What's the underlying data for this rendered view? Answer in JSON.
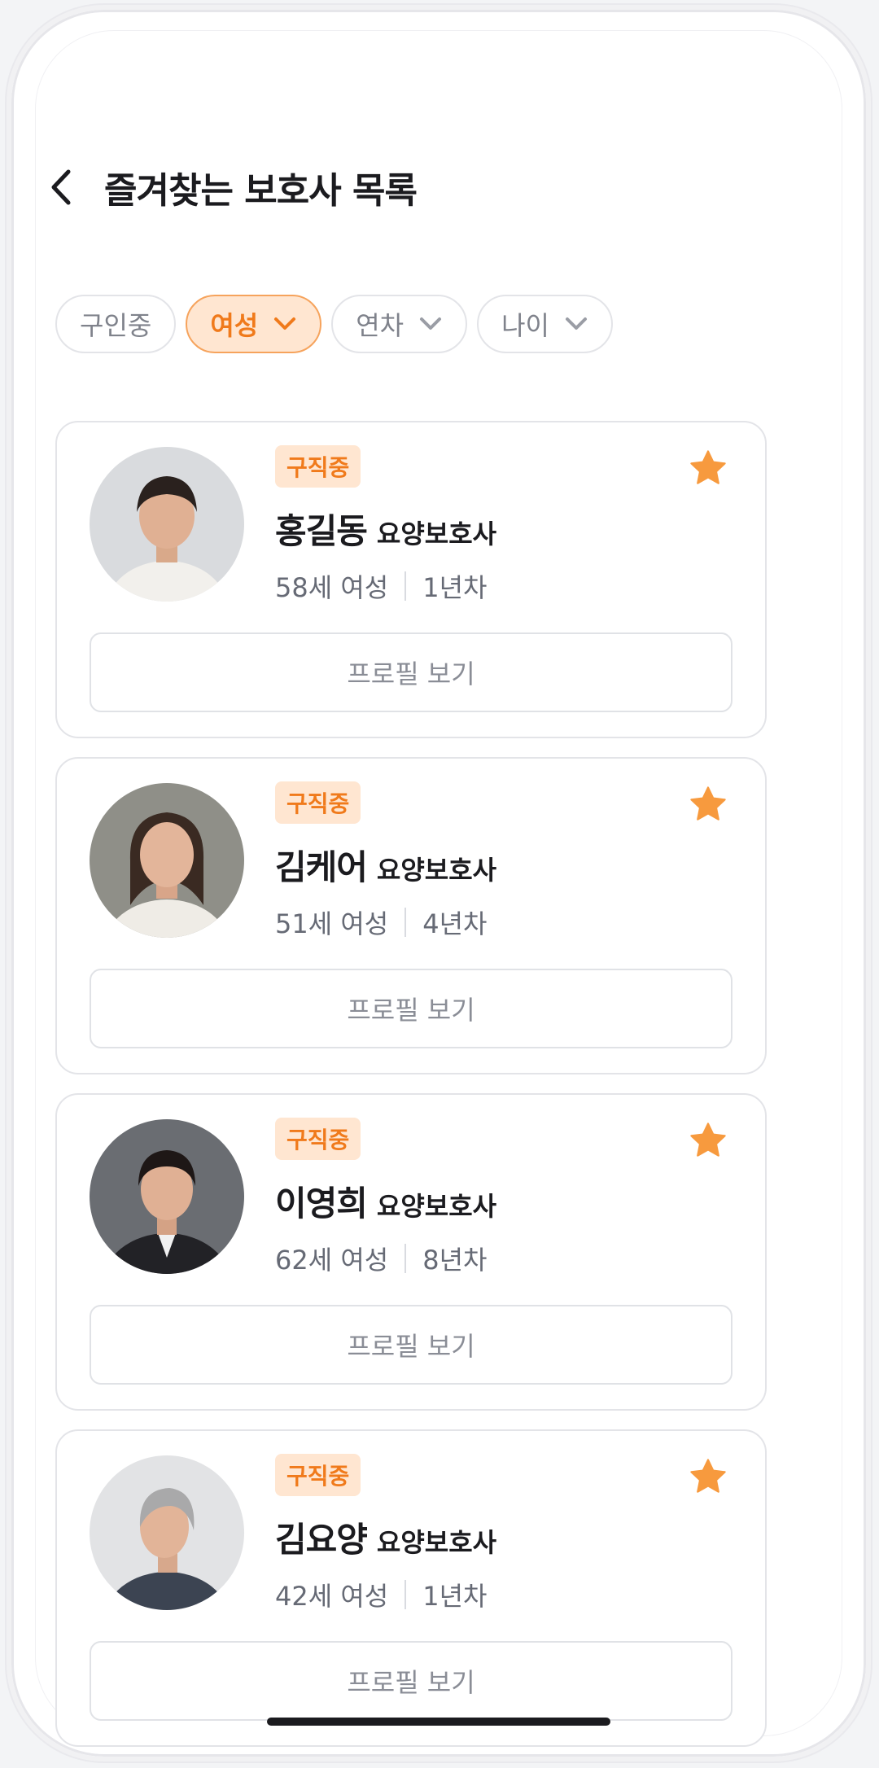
{
  "header": {
    "title": "즐겨찾는 보호사 목록"
  },
  "filters": [
    {
      "label": "구인중",
      "active": false,
      "has_dropdown": false
    },
    {
      "label": "여성",
      "active": true,
      "has_dropdown": true
    },
    {
      "label": "연차",
      "active": false,
      "has_dropdown": true
    },
    {
      "label": "나이",
      "active": false,
      "has_dropdown": true
    }
  ],
  "caregivers": [
    {
      "status": "구직중",
      "name": "홍길동",
      "role": "요양보호사",
      "age_gender": "58세 여성",
      "experience": "1년차",
      "button": "프로필 보기",
      "favorited": true
    },
    {
      "status": "구직중",
      "name": "김케어",
      "role": "요양보호사",
      "age_gender": "51세 여성",
      "experience": "4년차",
      "button": "프로필 보기",
      "favorited": true
    },
    {
      "status": "구직중",
      "name": "이영희",
      "role": "요양보호사",
      "age_gender": "62세 여성",
      "experience": "8년차",
      "button": "프로필 보기",
      "favorited": true
    },
    {
      "status": "구직중",
      "name": "김요양",
      "role": "요양보호사",
      "age_gender": "42세 여성",
      "experience": "1년차",
      "button": "프로필 보기",
      "favorited": true
    }
  ],
  "colors": {
    "accent": "#f07a1b",
    "accent_bg": "#ffe6d1",
    "star": "#f79a3e",
    "text": "#1b1b1f",
    "muted": "#666a75"
  },
  "icons": {
    "back": "chevron-left-icon",
    "dropdown": "chevron-down-icon",
    "favorite": "star-icon"
  }
}
